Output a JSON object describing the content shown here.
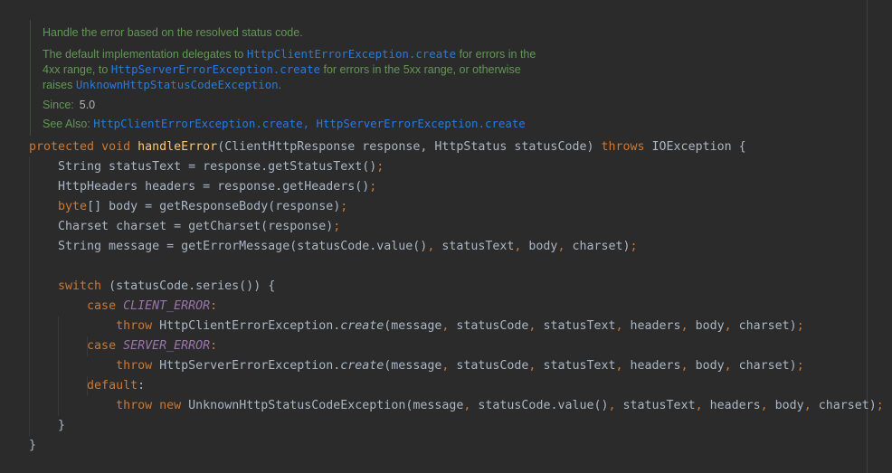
{
  "doc": {
    "line1": "Handle the error based on the resolved status code.",
    "l2_pre": "The default implementation delegates to ",
    "l2_link": "HttpClientErrorException.create",
    "l2_post": " for errors in the",
    "l3_pre": "4xx range, to ",
    "l3_link": "HttpServerErrorException.create",
    "l3_post": " for errors in the 5xx range, or otherwise",
    "l4_pre": "raises ",
    "l4_link": "UnknownHttpStatusCodeException",
    "l4_post": ".",
    "since_label": "Since:",
    "since_value": "5.0",
    "see_label": "See Also: ",
    "see_link1": "HttpClientErrorException.create",
    "see_sep": ", ",
    "see_link2": "HttpServerErrorException.create"
  },
  "code": {
    "l1": {
      "kw1": "protected",
      "kw2": "void",
      "fn": "handleError",
      "args": "(ClientHttpResponse response, HttpStatus statusCode) ",
      "kw3": "throws",
      "rest": " IOException {"
    },
    "l2": {
      "pre": "    String statusText = response.getStatusText()",
      "semi": ";"
    },
    "l3": {
      "pre": "    HttpHeaders headers = response.getHeaders()",
      "semi": ";"
    },
    "l4": {
      "indent": "    ",
      "kw": "byte",
      "rest": "[] body = getResponseBody(response)",
      "semi": ";"
    },
    "l5": {
      "pre": "    Charset charset = getCharset(response)",
      "semi": ";"
    },
    "l6": {
      "a": "    String message = getErrorMessage(statusCode.value()",
      "c1": ",",
      "b": " statusText",
      "c2": ",",
      "c": " body",
      "c3": ",",
      "d": " charset)",
      "semi": ";"
    },
    "l8": {
      "indent": "    ",
      "kw": "switch",
      "rest": " (statusCode.series()) {"
    },
    "l9": {
      "indent": "        ",
      "kw": "case",
      "sp": " ",
      "const": "CLIENT_ERROR",
      "colon": ":"
    },
    "l10": {
      "indent": "            ",
      "kw": "throw",
      "cls": " HttpClientErrorException.",
      "m": "create",
      "a": "(message",
      "c1": ",",
      "b": " statusCode",
      "c2": ",",
      "c": " statusText",
      "c3": ",",
      "d": " headers",
      "c4": ",",
      "e": " body",
      "c5": ",",
      "f": " charset)",
      "semi": ";"
    },
    "l11": {
      "indent": "        ",
      "kw": "case",
      "sp": " ",
      "const": "SERVER_ERROR",
      "colon": ":"
    },
    "l12": {
      "indent": "            ",
      "kw": "throw",
      "cls": " HttpServerErrorException.",
      "m": "create",
      "a": "(message",
      "c1": ",",
      "b": " statusCode",
      "c2": ",",
      "c": " statusText",
      "c3": ",",
      "d": " headers",
      "c4": ",",
      "e": " body",
      "c5": ",",
      "f": " charset)",
      "semi": ";"
    },
    "l13": {
      "indent": "        ",
      "kw": "default",
      "colon": ":"
    },
    "l14": {
      "indent": "            ",
      "kw": "throw",
      "sp": " ",
      "kw2": "new",
      "a": " UnknownHttpStatusCodeException(message",
      "c1": ",",
      "b": " statusCode.value()",
      "c2": ",",
      "c": " statusText",
      "c3": ",",
      "d": " headers",
      "c4": ",",
      "e": " body",
      "c5": ",",
      "f": " charset)",
      "semi": ";"
    },
    "l15": {
      "text": "    }"
    },
    "l16": {
      "text": "}"
    }
  }
}
